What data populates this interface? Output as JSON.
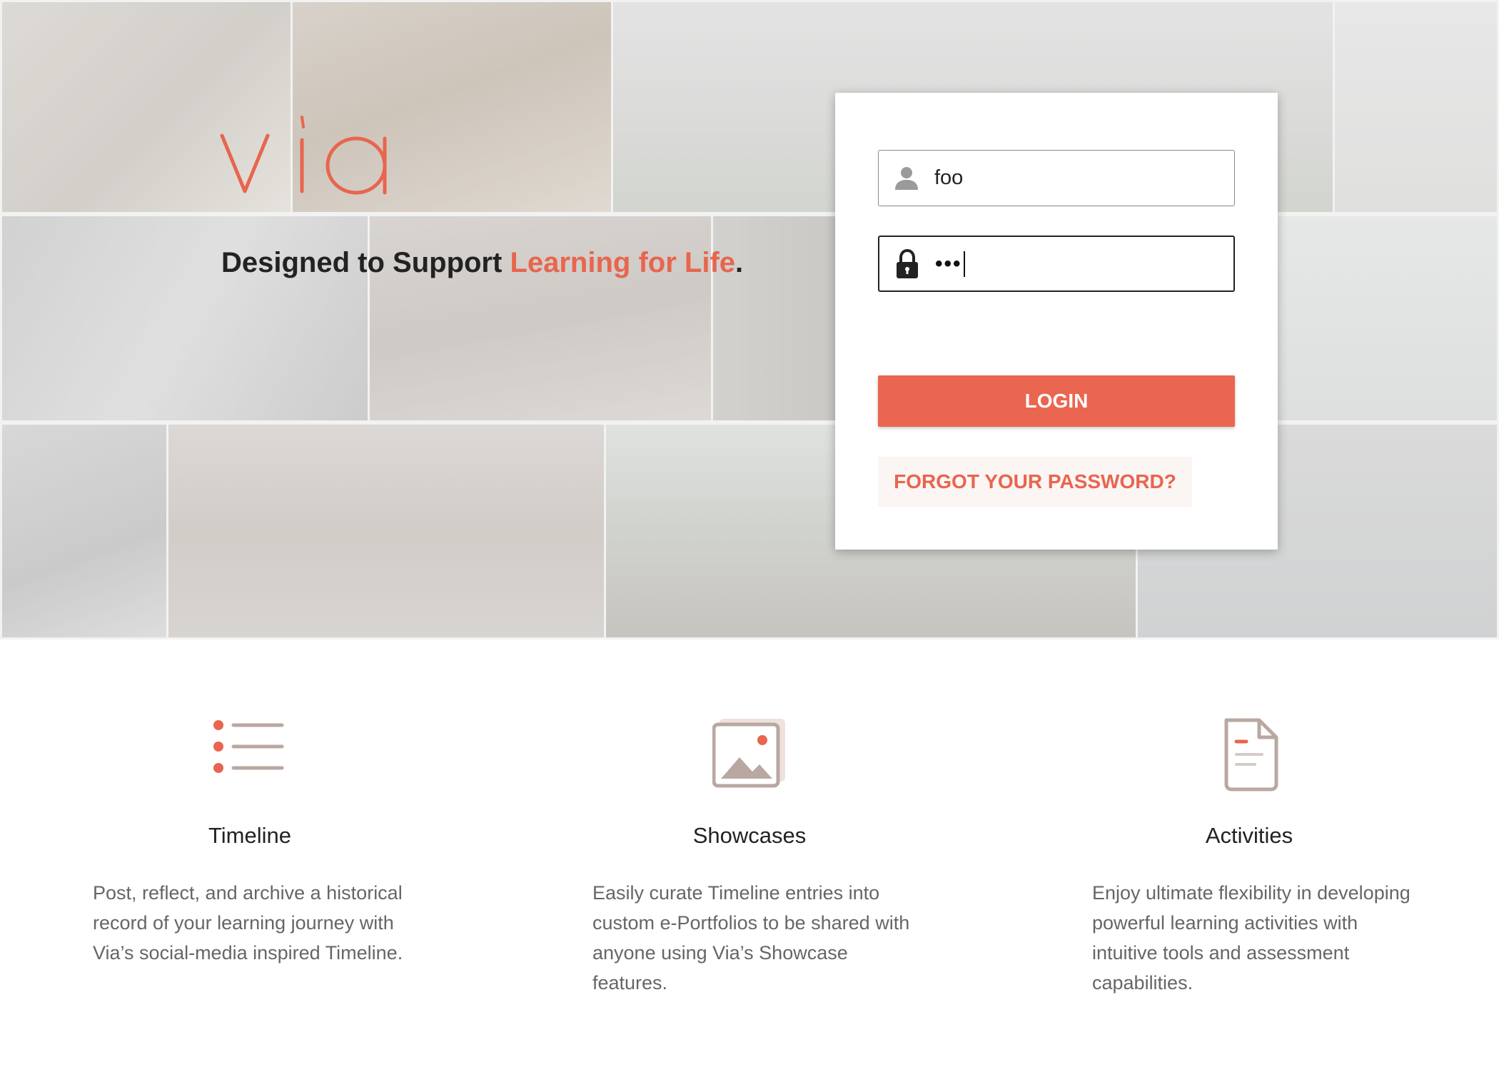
{
  "brand": {
    "logo_text": "via",
    "accent_color": "#e8654e"
  },
  "hero": {
    "tagline_prefix": "Designed to Support ",
    "tagline_accent": "Learning for Life",
    "tagline_suffix": "."
  },
  "login": {
    "username": {
      "value": "foo",
      "icon": "user-icon"
    },
    "password": {
      "masked_value": "•••",
      "icon": "lock-icon"
    },
    "login_label": "LOGIN",
    "forgot_label": "FORGOT YOUR PASSWORD?"
  },
  "features": [
    {
      "icon": "list-icon",
      "title": "Timeline",
      "text": "Post, reflect, and archive a historical record of your learning journey with Via’s social-media inspired Timeline."
    },
    {
      "icon": "image-icon",
      "title": "Showcases",
      "text": "Easily curate Timeline entries into custom e-Portfolios to be shared with anyone using Via’s Showcase features."
    },
    {
      "icon": "document-icon",
      "title": "Activities",
      "text": "Enjoy ultimate flexibility in developing powerful learning activities with intuitive tools and assessment capabilities."
    }
  ]
}
